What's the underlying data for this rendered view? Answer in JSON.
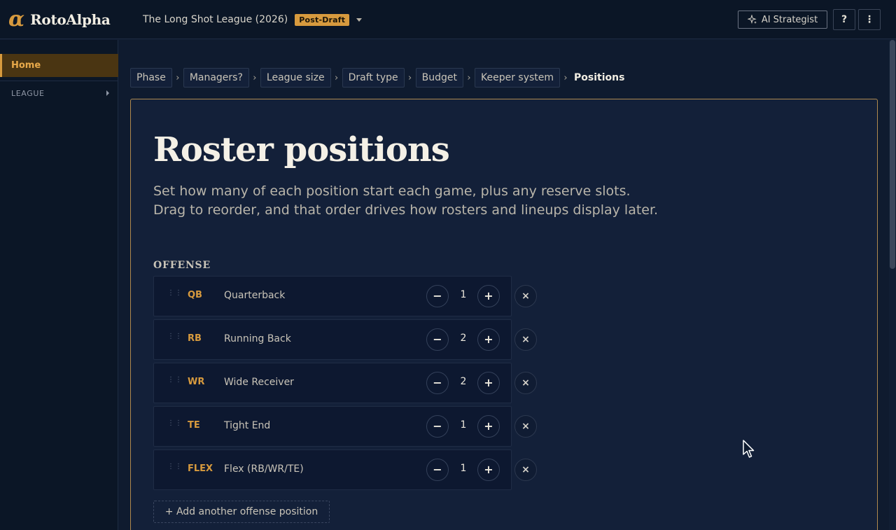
{
  "app": {
    "name": "RotoAlpha",
    "logo_glyph": "α",
    "accent": "#d79a3e"
  },
  "header": {
    "league_name": "The Long Shot League (2026)",
    "phase_badge": "Post-Draft",
    "ai_button": "AI Strategist",
    "help_label": "?",
    "more_label": "⋮"
  },
  "sidebar": {
    "home": "Home",
    "league_section": "LEAGUE"
  },
  "breadcrumb": {
    "items": [
      "Phase",
      "Managers?",
      "League size",
      "Draft type",
      "Budget",
      "Keeper system"
    ],
    "current": "Positions",
    "separator": "›"
  },
  "main": {
    "title": "Roster positions",
    "description": "Set how many of each position start each game, plus any reserve slots. Drag to reorder, and that order drives how rosters and lineups display later.",
    "section": "OFFENSE",
    "positions": [
      {
        "abbr": "QB",
        "name": "Quarterback",
        "count": "1"
      },
      {
        "abbr": "RB",
        "name": "Running Back",
        "count": "2"
      },
      {
        "abbr": "WR",
        "name": "Wide Receiver",
        "count": "2"
      },
      {
        "abbr": "TE",
        "name": "Tight End",
        "count": "1"
      },
      {
        "abbr": "FLEX",
        "name": "Flex (RB/WR/TE)",
        "count": "1"
      }
    ],
    "stepper": {
      "minus": "−",
      "plus": "+",
      "remove": "×"
    },
    "add_button": "+ Add another offense position"
  }
}
